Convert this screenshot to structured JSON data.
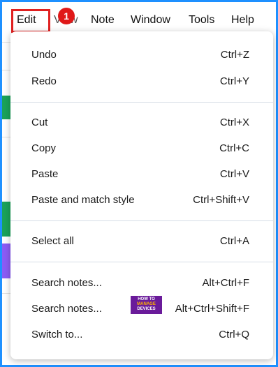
{
  "menubar": {
    "items": [
      "Edit",
      "View",
      "Note",
      "Window",
      "Tools",
      "Help"
    ],
    "step_badge": "1"
  },
  "edit_menu": {
    "groups": [
      [
        {
          "label": "Undo",
          "shortcut": "Ctrl+Z"
        },
        {
          "label": "Redo",
          "shortcut": "Ctrl+Y"
        }
      ],
      [
        {
          "label": "Cut",
          "shortcut": "Ctrl+X"
        },
        {
          "label": "Copy",
          "shortcut": "Ctrl+C"
        },
        {
          "label": "Paste",
          "shortcut": "Ctrl+V"
        },
        {
          "label": "Paste and match style",
          "shortcut": "Ctrl+Shift+V"
        }
      ],
      [
        {
          "label": "Select all",
          "shortcut": "Ctrl+A"
        }
      ],
      [
        {
          "label": "Search notes...",
          "shortcut": "Alt+Ctrl+F"
        },
        {
          "label": "Search notes...",
          "shortcut": "Alt+Ctrl+Shift+F"
        },
        {
          "label": "Switch to...",
          "shortcut": "Ctrl+Q"
        }
      ]
    ]
  },
  "watermark": {
    "line1": "HOW TO",
    "line2": "MANAGE",
    "line3": "DEVICES"
  },
  "colors": {
    "frame": "#1e90ff",
    "highlight_box": "#e02020",
    "badge": "#e01818"
  }
}
